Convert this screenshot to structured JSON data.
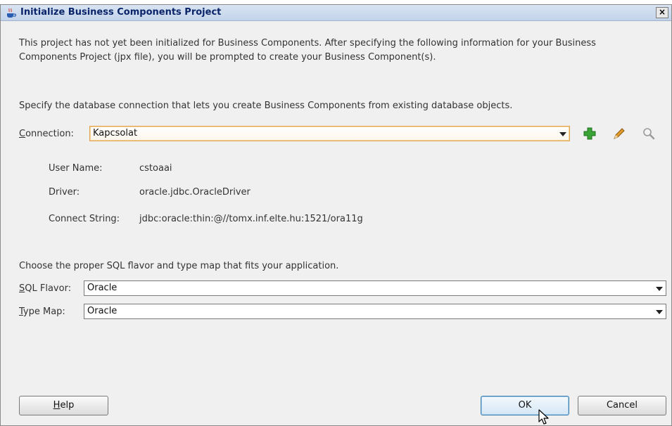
{
  "window": {
    "title": "Initialize Business Components Project",
    "close_label": "×"
  },
  "intro": {
    "line1": "This project has not yet been initialized for Business Components.  After specifying the following information for your Business",
    "line2": "Components Project (jpx file), you will be prompted to create your Business Component(s)."
  },
  "connection_section": {
    "instruction": "Specify the database connection that lets you create Business Components from existing database objects.",
    "label_mnemonic": "C",
    "label_rest": "onnection:",
    "value": "Kapcsolat",
    "user_name_label": "User Name:",
    "user_name_value": "cstoaai",
    "driver_label": "Driver:",
    "driver_value": "oracle.jdbc.OracleDriver",
    "connect_string_label": "Connect String:",
    "connect_string_value": "jdbc:oracle:thin:@//tomx.inf.elte.hu:1521/ora11g"
  },
  "sql_section": {
    "instruction": "Choose the proper SQL flavor and type map that fits your application.",
    "flavor_label_mnemonic": "S",
    "flavor_label_rest": "QL Flavor:",
    "flavor_value": "Oracle",
    "typemap_label_mnemonic": "T",
    "typemap_label_rest": "ype Map:",
    "typemap_value": "Oracle"
  },
  "buttons": {
    "help_mnemonic": "H",
    "help_rest": "elp",
    "ok_label": "OK",
    "cancel_label": "Cancel"
  },
  "icons": {
    "add": "plus-icon",
    "edit": "pencil-icon",
    "browse": "magnifier-icon"
  },
  "colors": {
    "title_text": "#0a246a",
    "focus_border": "#e0a24c",
    "default_button_border": "#3c7fb1",
    "add_icon": "#3aa335",
    "edit_icon": "#e29a2a"
  }
}
